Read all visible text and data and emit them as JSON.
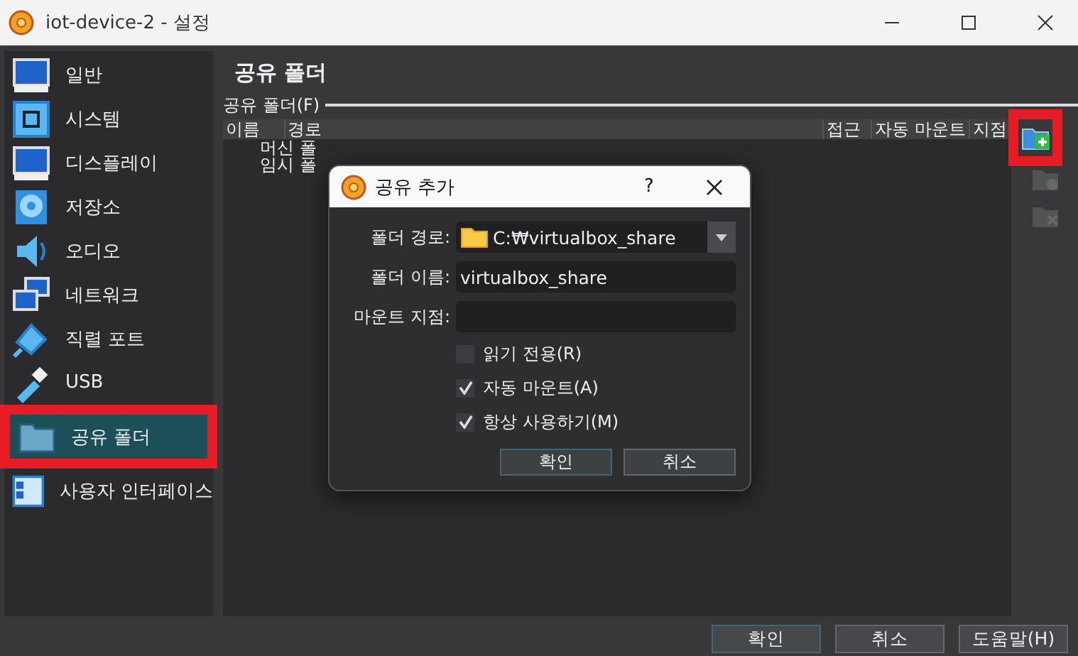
{
  "window": {
    "title": "iot-device-2 - 설정"
  },
  "sidebar": {
    "items": [
      {
        "label": "일반",
        "selected": false,
        "highlighted": false
      },
      {
        "label": "시스템",
        "selected": false,
        "highlighted": false
      },
      {
        "label": "디스플레이",
        "selected": false,
        "highlighted": false
      },
      {
        "label": "저장소",
        "selected": false,
        "highlighted": false
      },
      {
        "label": "오디오",
        "selected": false,
        "highlighted": false
      },
      {
        "label": "네트워크",
        "selected": false,
        "highlighted": false
      },
      {
        "label": "직렬 포트",
        "selected": false,
        "highlighted": false
      },
      {
        "label": "USB",
        "selected": false,
        "highlighted": false
      },
      {
        "label": "공유 폴더",
        "selected": true,
        "highlighted": true
      },
      {
        "label": "사용자 인터페이스",
        "selected": false,
        "highlighted": false
      }
    ]
  },
  "page": {
    "heading": "공유 폴더",
    "group_label": "공유 폴더(F)",
    "table": {
      "columns": [
        "이름",
        "경로",
        "접근",
        "자동 마운트",
        "지점"
      ],
      "rows": [
        {
          "name": "머신 폴"
        },
        {
          "name": "임시 폴"
        }
      ]
    },
    "toolbar": [
      {
        "kind": "add",
        "disabled": false,
        "highlighted": true
      },
      {
        "kind": "edit",
        "disabled": true,
        "highlighted": false
      },
      {
        "kind": "remove",
        "disabled": true,
        "highlighted": false
      }
    ]
  },
  "dialog": {
    "title": "공유 추가",
    "help": "?",
    "fields": [
      {
        "label": "폴더 경로:",
        "kind": "combo",
        "value": "C:₩virtualbox_share"
      },
      {
        "label": "폴더 이름:",
        "kind": "text",
        "value": "virtualbox_share"
      },
      {
        "label": "마운트 지점:",
        "kind": "text"
      }
    ],
    "checkboxes": [
      {
        "label": "읽기 전용(R)",
        "checked": false
      },
      {
        "label": "자동 마운트(A)",
        "checked": true
      },
      {
        "label": "항상 사용하기(M)",
        "checked": true
      }
    ],
    "buttons": [
      {
        "label": "확인",
        "default": true
      },
      {
        "label": "취소",
        "default": false
      }
    ]
  },
  "buttons": [
    {
      "label": "확인",
      "default": true
    },
    {
      "label": "취소",
      "default": false
    },
    {
      "label": "도움말(H)",
      "default": false
    }
  ]
}
